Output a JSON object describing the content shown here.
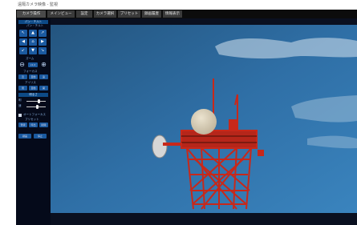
{
  "window": {
    "title": "遠隔カメラ映像 - 監視"
  },
  "tabs": [
    {
      "label": "カメラ操作"
    },
    {
      "label": "メインビュー"
    },
    {
      "label": "設定"
    },
    {
      "label": "カメラ選択"
    },
    {
      "label": "プリセット"
    },
    {
      "label": "録画履歴"
    },
    {
      "label": "情報表示"
    }
  ],
  "sidebar": {
    "section_ptz": "パン・チルト",
    "section_zoom": "ズーム",
    "zoom_label": "ズーム",
    "zoom_value": "x1.0",
    "section_focus": "フォーカス",
    "focus_buttons": [
      "近",
      "自動",
      "遠"
    ],
    "section_iris": "アイリス",
    "iris_buttons": [
      "閉",
      "自動",
      "開"
    ],
    "section_settings": "明るさ",
    "slider1_label": "明",
    "slider2_label": "速",
    "checkbox_label": "オートフォーカス",
    "section_preset": "プリセット",
    "preset_buttons": [
      "登録",
      "呼出",
      "削除"
    ],
    "bottom_buttons": [
      "録画",
      "停止"
    ]
  },
  "colors": {
    "sky": "#2f6fa6",
    "tower_red": "#c8281a",
    "panel_bg": "#050a1a",
    "button_blue": "#1b5aa0"
  }
}
